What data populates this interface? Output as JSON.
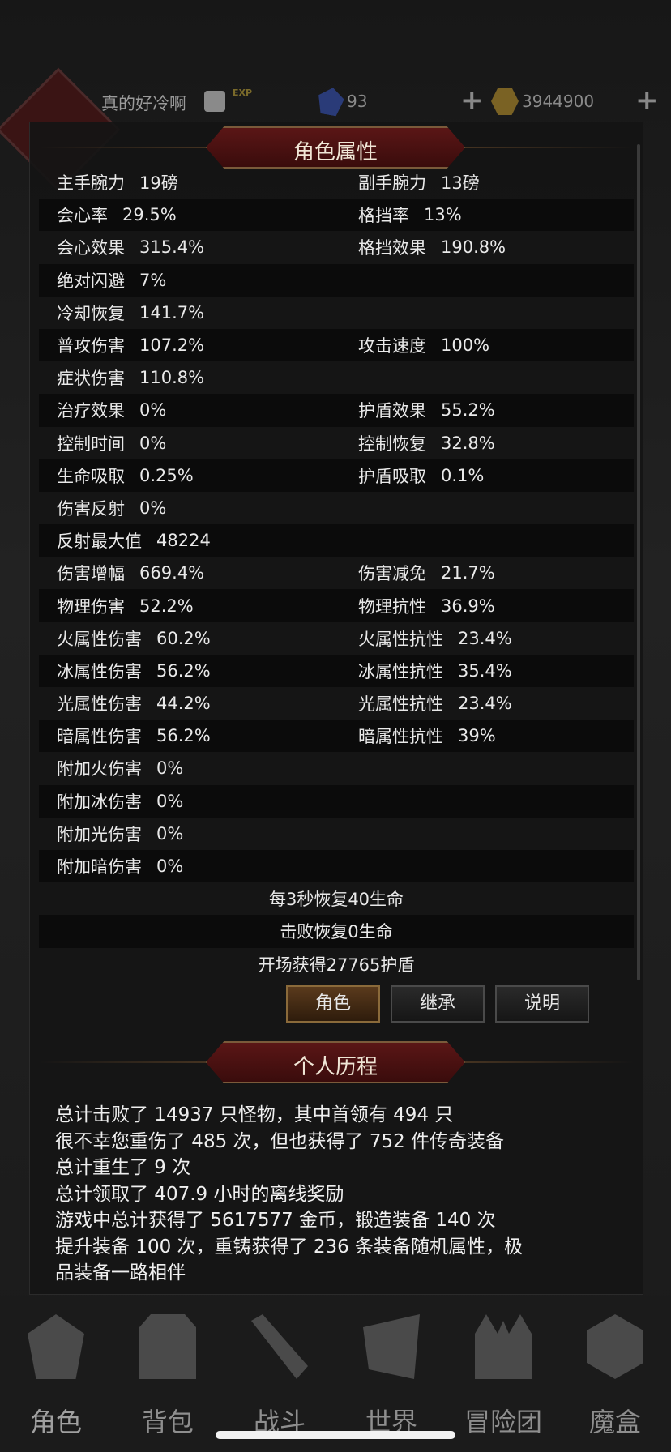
{
  "header": {
    "player_name": "真的好冷啊",
    "gems": "93",
    "gold": "3944900",
    "exp_icon_text": "EXP"
  },
  "attributes_panel": {
    "title": "角色属性",
    "rows": [
      {
        "left_label": "主手腕力",
        "left_value": "19磅",
        "right_label": "副手腕力",
        "right_value": "13磅"
      },
      {
        "left_label": "会心率",
        "left_value": "29.5%",
        "right_label": "格挡率",
        "right_value": "13%"
      },
      {
        "left_label": "会心效果",
        "left_value": "315.4%",
        "right_label": "格挡效果",
        "right_value": "190.8%"
      },
      {
        "left_label": "绝对闪避",
        "left_value": "7%",
        "right_label": "",
        "right_value": ""
      },
      {
        "left_label": "冷却恢复",
        "left_value": "141.7%",
        "right_label": "",
        "right_value": ""
      },
      {
        "left_label": "普攻伤害",
        "left_value": "107.2%",
        "right_label": "攻击速度",
        "right_value": "100%"
      },
      {
        "left_label": "症状伤害",
        "left_value": "110.8%",
        "right_label": "",
        "right_value": ""
      },
      {
        "left_label": "治疗效果",
        "left_value": "0%",
        "right_label": "护盾效果",
        "right_value": "55.2%"
      },
      {
        "left_label": "控制时间",
        "left_value": "0%",
        "right_label": "控制恢复",
        "right_value": "32.8%"
      },
      {
        "left_label": "生命吸取",
        "left_value": "0.25%",
        "right_label": "护盾吸取",
        "right_value": "0.1%"
      },
      {
        "left_label": "伤害反射",
        "left_value": "0%",
        "right_label": "",
        "right_value": ""
      },
      {
        "left_label": "反射最大值",
        "left_value": "48224",
        "right_label": "",
        "right_value": ""
      },
      {
        "left_label": "伤害增幅",
        "left_value": "669.4%",
        "right_label": "伤害减免",
        "right_value": "21.7%"
      },
      {
        "left_label": "物理伤害",
        "left_value": "52.2%",
        "right_label": "物理抗性",
        "right_value": "36.9%"
      },
      {
        "left_label": "火属性伤害",
        "left_value": "60.2%",
        "right_label": "火属性抗性",
        "right_value": "23.4%"
      },
      {
        "left_label": "冰属性伤害",
        "left_value": "56.2%",
        "right_label": "冰属性抗性",
        "right_value": "35.4%"
      },
      {
        "left_label": "光属性伤害",
        "left_value": "44.2%",
        "right_label": "光属性抗性",
        "right_value": "23.4%"
      },
      {
        "left_label": "暗属性伤害",
        "left_value": "56.2%",
        "right_label": "暗属性抗性",
        "right_value": "39%"
      },
      {
        "left_label": "附加火伤害",
        "left_value": "0%",
        "right_label": "",
        "right_value": ""
      },
      {
        "left_label": "附加冰伤害",
        "left_value": "0%",
        "right_label": "",
        "right_value": ""
      },
      {
        "left_label": "附加光伤害",
        "left_value": "0%",
        "right_label": "",
        "right_value": ""
      },
      {
        "left_label": "附加暗伤害",
        "left_value": "0%",
        "right_label": "",
        "right_value": ""
      }
    ],
    "center_rows": [
      "每3秒恢复40生命",
      "击败恢复0生命",
      "开场获得27765护盾"
    ],
    "buttons": {
      "character": "角色",
      "inherit": "继承",
      "explain": "说明"
    }
  },
  "history_panel": {
    "title": "个人历程",
    "lines": [
      "总计击败了 14937 只怪物，其中首领有 494 只",
      "很不幸您重伤了 485 次，但也获得了 752 件传奇装备",
      "总计重生了 9 次",
      "总计领取了 407.9 小时的离线奖励",
      "游戏中总计获得了 5617577 金币，锻造装备 140 次",
      "提升装备 100 次，重铸获得了 236 条装备随机属性，极",
      "品装备一路相伴"
    ]
  },
  "bottom_nav": {
    "items": [
      {
        "label": "角色",
        "icon": "helmet-icon"
      },
      {
        "label": "背包",
        "icon": "backpack-icon"
      },
      {
        "label": "战斗",
        "icon": "swords-icon"
      },
      {
        "label": "世界",
        "icon": "map-scroll-icon"
      },
      {
        "label": "冒险团",
        "icon": "castle-icon"
      },
      {
        "label": "魔盒",
        "icon": "magic-cube-icon"
      }
    ]
  }
}
